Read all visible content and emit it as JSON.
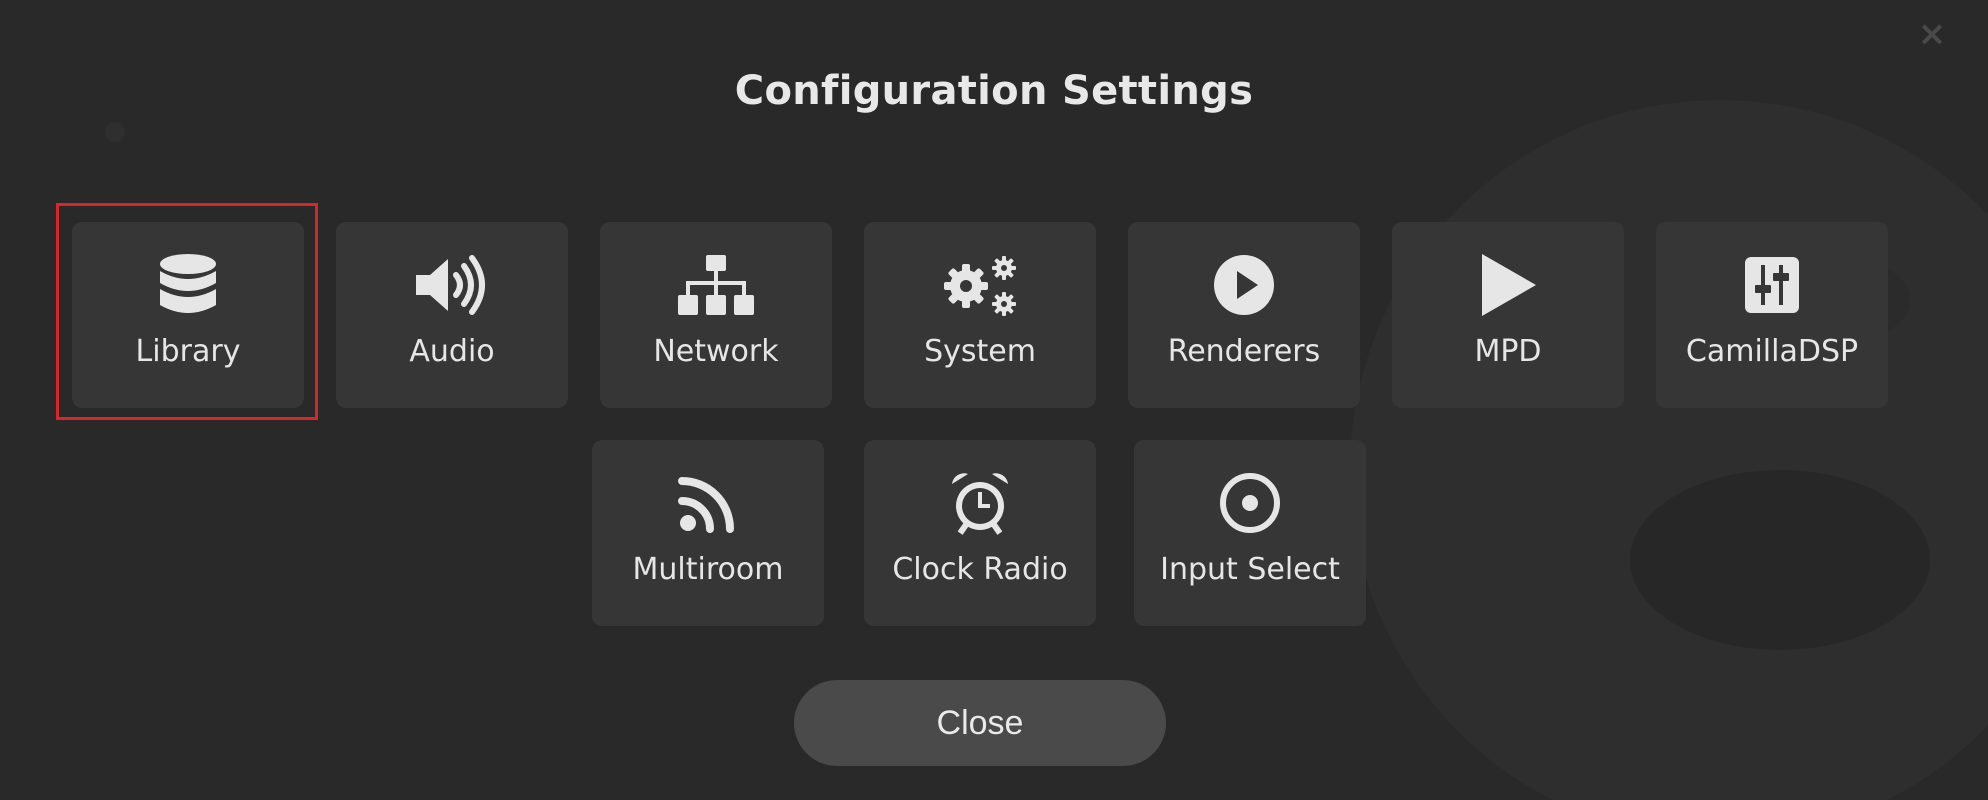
{
  "modal": {
    "title": "Configuration Settings",
    "close_label": "Close",
    "dismiss_glyph": "×",
    "tiles": [
      {
        "label": "Library",
        "icon": "database-icon"
      },
      {
        "label": "Audio",
        "icon": "volume-icon"
      },
      {
        "label": "Network",
        "icon": "sitemap-icon"
      },
      {
        "label": "System",
        "icon": "cogs-icon"
      },
      {
        "label": "Renderers",
        "icon": "play-circle-icon"
      },
      {
        "label": "MPD",
        "icon": "play-icon"
      },
      {
        "label": "CamillaDSP",
        "icon": "sliders-icon"
      },
      {
        "label": "Multiroom",
        "icon": "rss-icon"
      },
      {
        "label": "Clock Radio",
        "icon": "alarm-clock-icon"
      },
      {
        "label": "Input Select",
        "icon": "dot-circle-icon"
      }
    ]
  },
  "colors": {
    "background": "#292929",
    "tile": "#363636",
    "highlight": "#d8262a",
    "close_button": "#4a4a4a",
    "text": "#e6e6e6"
  }
}
